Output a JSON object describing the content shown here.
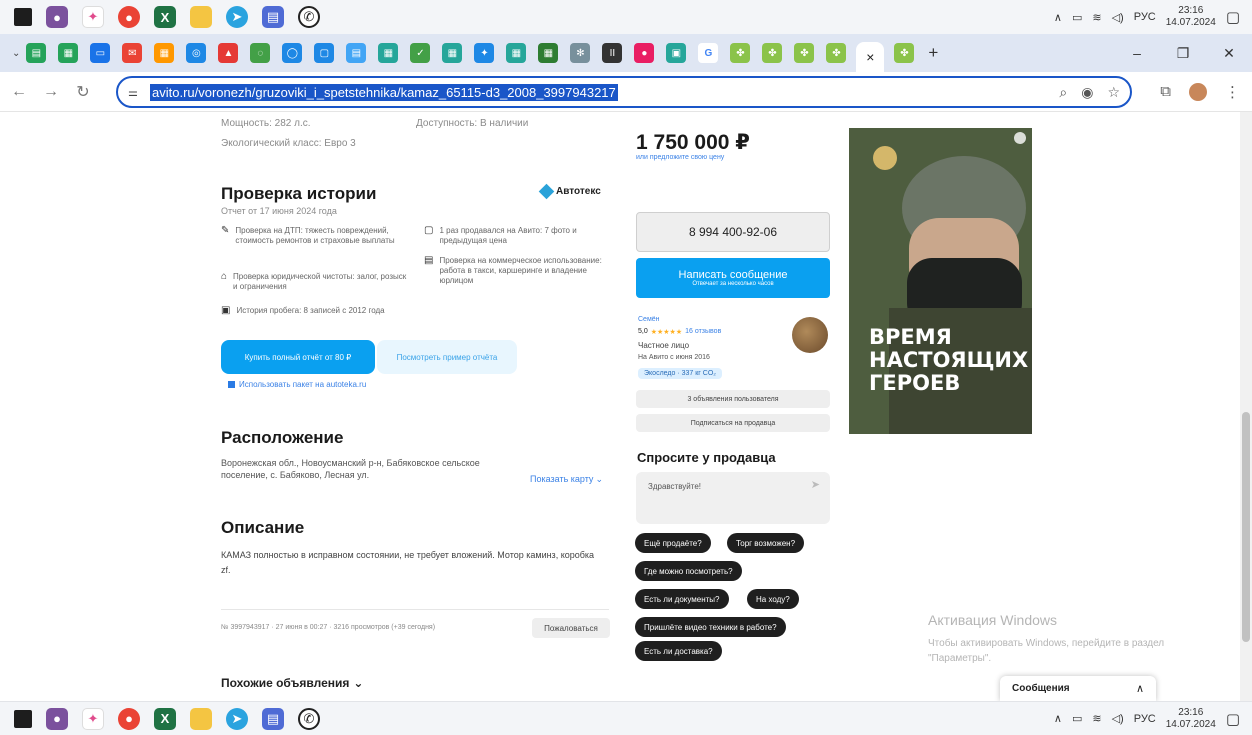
{
  "os": {
    "lang": "РУС",
    "time": "23:16",
    "date": "14.07.2024"
  },
  "browser": {
    "url": "avito.ru/voronezh/gruzoviki_i_spetstehnika/kamaz_65115-d3_2008_3997943217"
  },
  "specs": {
    "power": "Мощность: 282 л.с.",
    "eco_class": "Экологический класс: Евро 3",
    "availability": "Доступность: В наличии"
  },
  "history": {
    "title": "Проверка истории",
    "brand": "Автотекс",
    "report_date": "Отчет от 17 июня 2024 года",
    "items_left": [
      "Проверка на ДТП: тяжесть повреждений, стоимость ремонтов и страховые выплаты",
      "Проверка юридической чистоты: залог, розыск и ограничения",
      "История пробега: 8 записей с 2012 года"
    ],
    "items_right": [
      "1 раз продавался на Авито: 7 фото и предыдущая цена",
      "Проверка на коммерческое использование: работа в такси, каршеринге и владение юрлицом"
    ],
    "buy_button": "Купить полный отчёт от 80 ₽",
    "example_button": "Посмотреть пример отчёта",
    "package_link": "Использовать пакет на autoteka.ru"
  },
  "location": {
    "title": "Расположение",
    "address": "Воронежская обл., Новоусманский р-н, Бабяковское сельское поселение, с. Бабяково, Лесная ул.",
    "map_link": "Показать карту"
  },
  "description": {
    "title": "Описание",
    "text": "КАМАЗ полностью в исправном состоянии, не требует вложений. Мотор каминз, коробка zf."
  },
  "footer_meta": {
    "info": "№ 3997943917 · 27 июня в 00:27 · 3216 просмотров (+39 сегодня)",
    "complain": "Пожаловаться"
  },
  "similar": {
    "title": "Похожие объявления"
  },
  "price": {
    "value": "1 750 000 ₽",
    "offer_link": "или предложите свою цену"
  },
  "seller": {
    "phone": "8 994 400-92-06",
    "write_button": "Написать сообщение",
    "write_sub": "Отвечает за несколько часов",
    "name": "Семён",
    "rating": "5,0",
    "stars": "★★★★★",
    "reviews": "16 отзывов",
    "type": "Частное лицо",
    "since": "На Авито с июня 2016",
    "badge": "Экоследо · 337 кг CO₂",
    "all_ads": "3 объявления пользователя",
    "subscribe": "Подписаться на продавца"
  },
  "ask": {
    "title": "Спросите у продавца",
    "placeholder": "Здравствуйте!",
    "questions": [
      "Ещё продаёте?",
      "Торг возможен?",
      "Где можно посмотреть?",
      "Есть ли документы?",
      "На ходу?",
      "Пришлёте видео техники в работе?",
      "Есть ли доставка?"
    ]
  },
  "ad_banner": {
    "headline_1": "ВРЕМЯ",
    "headline_2": "НАСТОЯЩИХ",
    "headline_3": "ГЕРОЕВ"
  },
  "windows_watermark": {
    "title": "Активация Windows",
    "text": "Чтобы активировать Windows, перейдите в раздел \"Параметры\"."
  },
  "messages_popup": {
    "label": "Сообщения"
  }
}
